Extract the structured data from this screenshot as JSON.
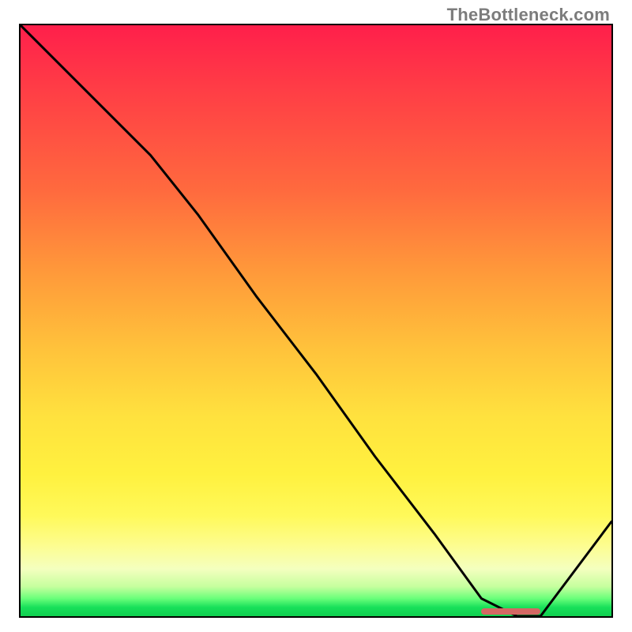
{
  "attribution": "TheBottleneck.com",
  "colors": {
    "gradient_top": "#ff1f4b",
    "gradient_mid1": "#ff9a3a",
    "gradient_mid2": "#ffe13e",
    "gradient_bottom": "#10d050",
    "curve": "#000000",
    "marker_bar": "#d46864",
    "border": "#000000"
  },
  "chart_data": {
    "type": "line",
    "title": "",
    "xlabel": "",
    "ylabel": "",
    "xlim": [
      0,
      100
    ],
    "ylim": [
      0,
      100
    ],
    "grid": false,
    "legend": false,
    "series": [
      {
        "name": "bottleneck-curve",
        "x": [
          0,
          10,
          22,
          30,
          40,
          50,
          60,
          70,
          78,
          84,
          88,
          100
        ],
        "y": [
          100,
          90,
          78,
          68,
          54,
          41,
          27,
          14,
          3,
          0,
          0,
          16
        ]
      }
    ],
    "marker_bar": {
      "x_start": 78,
      "x_end": 88,
      "y": 0.8
    }
  }
}
